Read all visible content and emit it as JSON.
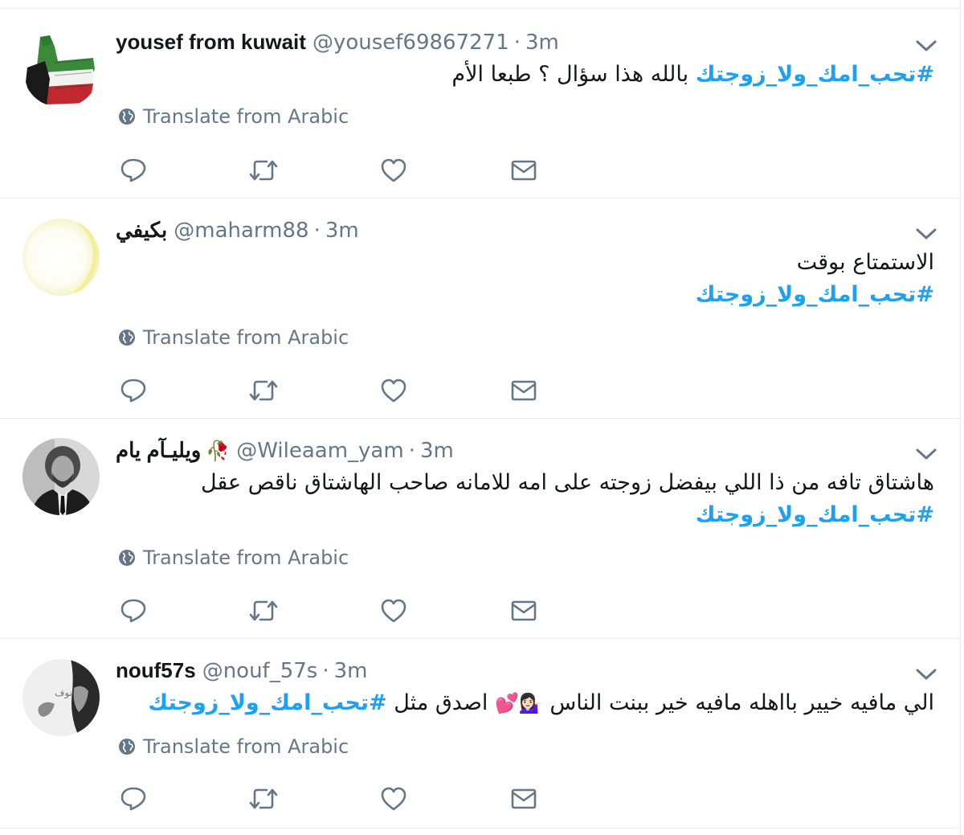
{
  "ui": {
    "translate_label": "Translate from Arabic",
    "dot": "·",
    "colors": {
      "link": "#1da1f2",
      "secondary": "#657786",
      "text": "#14171a",
      "divider": "#e6ecf0"
    },
    "icons": [
      "reply-icon",
      "retweet-icon",
      "like-icon",
      "direct-message-icon",
      "globe-icon",
      "chevron-down-icon"
    ]
  },
  "tweets": [
    {
      "name": "yousef from kuwait",
      "handle": "@yousef69867271",
      "time": "3m",
      "line1_hashtag": "#تحب_امك_ولا_زوجتك",
      "line1_text": " بالله هذا سؤال ؟ طبعا الأم"
    },
    {
      "name": "بكيفي",
      "handle": "@maharm88",
      "time": "3m",
      "line1_text": "الاستمتاع بوقت",
      "line2_hashtag": "#تحب_امك_ولا_زوجتك"
    },
    {
      "name": "ويليـآم يام",
      "name_emoji": "🥀",
      "handle": "@Wileaam_yam",
      "time": "3m",
      "line1_text": "هاشتاق تافه من ذا اللي بيفضل زوجته على امه للامانه صاحب الهاشتاق ناقص عقل",
      "line2_hashtag": "#تحب_امك_ولا_زوجتك"
    },
    {
      "name": "nouf57s",
      "handle": "@nouf_57s",
      "time": "3m",
      "line1_text": "الي مافيه خيير بااهله مافيه خير ببنت الناس ",
      "line1_emoji": "💁🏻‍♀️💕",
      "line1_text2": " اصدق مثل  ",
      "line1_hashtag": "#تحب_امك_ولا_زوجتك"
    }
  ]
}
